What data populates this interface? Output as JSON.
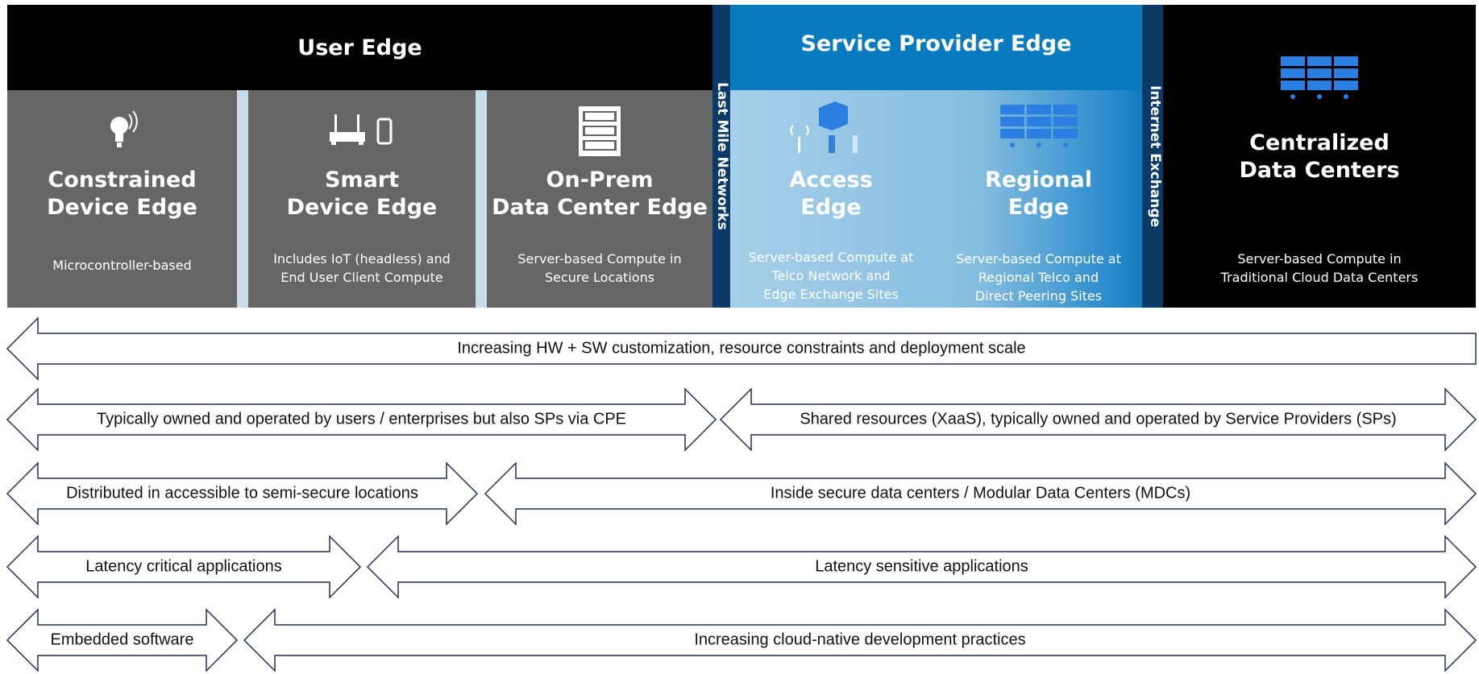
{
  "user_edge": {
    "title": "User Edge",
    "columns": [
      {
        "title1": "Constrained",
        "title2": "Device Edge",
        "desc1": "Microcontroller-based",
        "desc2": "",
        "icon": "smart-bulb-icon"
      },
      {
        "title1": "Smart",
        "title2": "Device Edge",
        "desc1": "Includes IoT (headless) and",
        "desc2": "End User Client Compute",
        "icon": "router-phone-icon"
      },
      {
        "title1": "On-Prem",
        "title2": "Data Center Edge",
        "desc1": "Server-based Compute in",
        "desc2": "Secure Locations",
        "icon": "server-rack-icon"
      }
    ]
  },
  "last_mile": "Last Mile Networks",
  "sp_edge": {
    "title": "Service Provider Edge",
    "columns": [
      {
        "title1": "Access",
        "title2": "Edge",
        "desc1": "Server-based Compute at",
        "desc2": "Telco Network and",
        "desc3": "Edge Exchange Sites",
        "icon": "container-tower-icon"
      },
      {
        "title1": "Regional",
        "title2": "Edge",
        "desc1": "Server-based Compute at",
        "desc2": "Regional Telco and",
        "desc3": "Direct Peering Sites",
        "icon": "server-grid-icon"
      }
    ]
  },
  "internet_exchange": "Internet Exchange",
  "centralized": {
    "title1": "Centralized",
    "title2": "Data Centers",
    "desc1": "Server-based Compute in",
    "desc2": "Traditional Cloud Data Centers",
    "icon": "data-center-icon"
  },
  "arrows": [
    {
      "label": "Increasing HW + SW customization, resource constraints and deployment scale",
      "direction": "left"
    },
    {
      "label": "Typically owned and operated by users / enterprises but also SPs via CPE",
      "direction": "both"
    },
    {
      "label": "Shared resources (XaaS), typically owned and operated by Service Providers (SPs)",
      "direction": "both"
    },
    {
      "label": "Distributed in accessible to semi-secure locations",
      "direction": "both"
    },
    {
      "label": "Inside secure data centers / Modular Data Centers (MDCs)",
      "direction": "both"
    },
    {
      "label": "Latency critical applications",
      "direction": "both"
    },
    {
      "label": "Latency sensitive applications",
      "direction": "both"
    },
    {
      "label": "Embedded software",
      "direction": "both"
    },
    {
      "label": "Increasing cloud-native development practices",
      "direction": "both"
    }
  ],
  "colors": {
    "gray": "#666666",
    "sp_header": "#0a7abf",
    "strip": "#0b3a66",
    "arrow_stroke": "#1f2f55"
  }
}
